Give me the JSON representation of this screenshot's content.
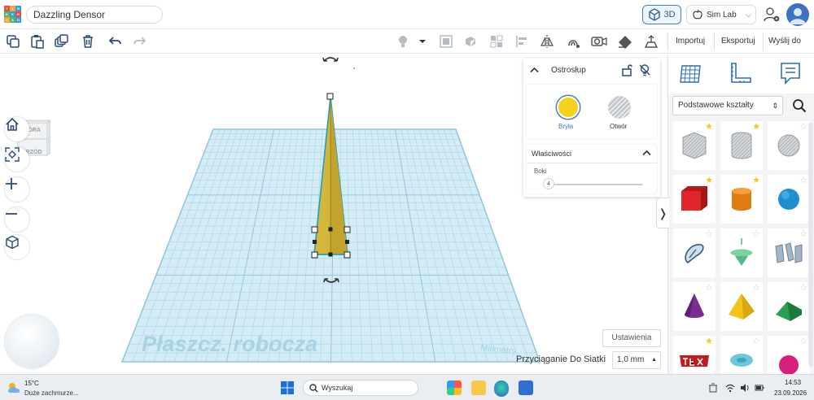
{
  "header": {
    "project_title": "Dazzling Densor",
    "mode_3d": "3D",
    "sim_lab": "Sim Lab"
  },
  "toolbar": {
    "import": "Importuj",
    "export": "Eksportuj",
    "send_to": "Wyślij do"
  },
  "viewcube": {
    "top": "GÓRA",
    "front": "PRZÓD"
  },
  "workplane": {
    "label": "Płaszcz. robocza",
    "units": "Milimetry"
  },
  "inspector": {
    "title": "Ostrosłup",
    "solid": "Bryła",
    "hole": "Otwór",
    "properties_title": "Właściwości",
    "sides_label": "Boki",
    "sides_value": "4",
    "solid_color": "#f5d31d"
  },
  "shapes_panel": {
    "category": "Podstawowe kształty"
  },
  "canvas_footer": {
    "settings": "Ustawienia",
    "snap_label": "Przyciąganie Do Siatki",
    "snap_value": "1,0 mm"
  },
  "taskbar": {
    "temperature": "15°C",
    "weather": "Duże zachmurze...",
    "search_placeholder": "Wyszukaj",
    "time": "14:53",
    "date": "23.09.2026"
  },
  "colors": {
    "accent": "#3b72c4",
    "workplane": "#cfe9f4",
    "pyramid": "#d4b63a"
  }
}
